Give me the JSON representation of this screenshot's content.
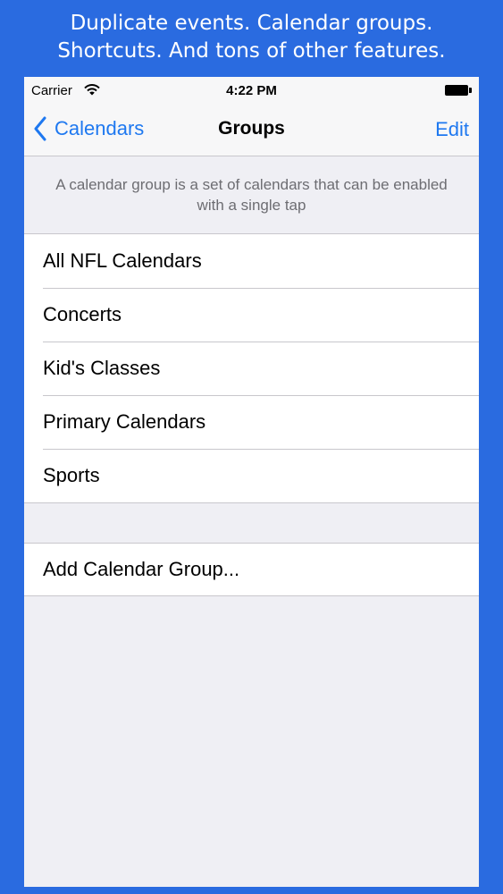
{
  "promo": {
    "line1": "Duplicate events. Calendar groups.",
    "line2": "Shortcuts. And tons of other features."
  },
  "status_bar": {
    "carrier": "Carrier",
    "time": "4:22 PM",
    "icons": [
      "wifi-icon",
      "battery-icon"
    ]
  },
  "nav": {
    "back_label": "Calendars",
    "title": "Groups",
    "edit_label": "Edit",
    "back_icon": "chevron-left-icon"
  },
  "description": "A calendar group is a set of calendars that can be enabled with a single tap",
  "groups": [
    {
      "label": "All NFL Calendars"
    },
    {
      "label": "Concerts"
    },
    {
      "label": "Kid's Classes"
    },
    {
      "label": "Primary Calendars"
    },
    {
      "label": "Sports"
    }
  ],
  "add_group_label": "Add Calendar Group...",
  "colors": {
    "background": "#2a6be0",
    "accent": "#1e78f0",
    "table_background": "#efeff4"
  }
}
